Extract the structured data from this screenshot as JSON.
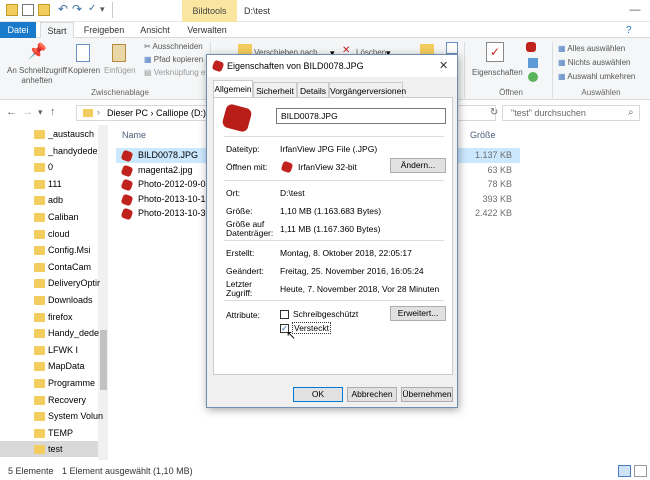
{
  "window": {
    "title": "D:\\test",
    "context_tab": "Bildtools"
  },
  "tabs": [
    "Datei",
    "Start",
    "Freigeben",
    "Ansicht",
    "Verwalten"
  ],
  "ribbon": {
    "pin": "An Schnellzugriff anheften",
    "copy": "Kopieren",
    "paste": "Einfügen",
    "cut": "Ausschneiden",
    "copy_path": "Pfad kopieren",
    "paste_shortcut": "Verknüpfung e",
    "group_clipboard": "Zwischenablage",
    "move_to": "Verschieben nach",
    "delete": "Löschen",
    "properties": "Eigenschaften",
    "group_open": "Öffnen",
    "select_all": "Alles auswählen",
    "select_none": "Nichts auswählen",
    "invert_selection": "Auswahl umkehren",
    "group_select": "Auswählen"
  },
  "address": {
    "path": "Dieser PC  ›  Calliope (D:)",
    "search_placeholder": "\"test\" durchsuchen"
  },
  "nav_items": [
    "_austausch",
    "_handydede",
    "0",
    "111",
    "adb",
    "Caliban",
    "cloud",
    "Config.Msi",
    "ContaCam",
    "DeliveryOptir",
    "Downloads",
    "firefox",
    "Handy_dede",
    "LFWK I",
    "MapData",
    "Programme",
    "Recovery",
    "System Volun",
    "TEMP",
    "test"
  ],
  "list": {
    "col_name": "Name",
    "col_size": "Größe",
    "files": [
      {
        "name": "BILD0078.JPG",
        "size": "1.137 KB"
      },
      {
        "name": "magenta2.jpg",
        "size": "63 KB"
      },
      {
        "name": "Photo-2012-09-04-",
        "size": "78 KB"
      },
      {
        "name": "Photo-2013-10-13-",
        "size": "393 KB"
      },
      {
        "name": "Photo-2013-10-30-",
        "size": "2.422 KB"
      }
    ]
  },
  "status": {
    "count": "5 Elemente",
    "selection": "1 Element ausgewählt (1,10 MB)"
  },
  "dialog": {
    "title": "Eigenschaften von BILD0078.JPG",
    "tabs": [
      "Allgemein",
      "Sicherheit",
      "Details",
      "Vorgängerversionen"
    ],
    "filename": "BILD0078.JPG",
    "type_label": "Dateityp:",
    "type_value": "IrfanView JPG File (.JPG)",
    "opens_label": "Öffnen mit:",
    "opens_value": "IrfanView 32-bit",
    "change_button": "Ändern...",
    "location_label": "Ort:",
    "location_value": "D:\\test",
    "size_label": "Größe:",
    "size_value": "1,10 MB (1.163.683 Bytes)",
    "size_disk_label": "Größe auf Datenträger:",
    "size_disk_value": "1,11 MB (1.167.360 Bytes)",
    "created_label": "Erstellt:",
    "created_value": "Montag, 8. Oktober 2018, 22:05:17",
    "modified_label": "Geändert:",
    "modified_value": "Freitag, 25. November 2016, 16:05:24",
    "accessed_label": "Letzter Zugriff:",
    "accessed_value": "Heute, 7. November 2018, Vor 28 Minuten",
    "attributes_label": "Attribute:",
    "readonly_label": "Schreibgeschützt",
    "hidden_label": "Versteckt",
    "advanced_button": "Erweitert...",
    "ok_button": "OK",
    "cancel_button": "Abbrechen",
    "apply_button": "Übernehmen"
  }
}
